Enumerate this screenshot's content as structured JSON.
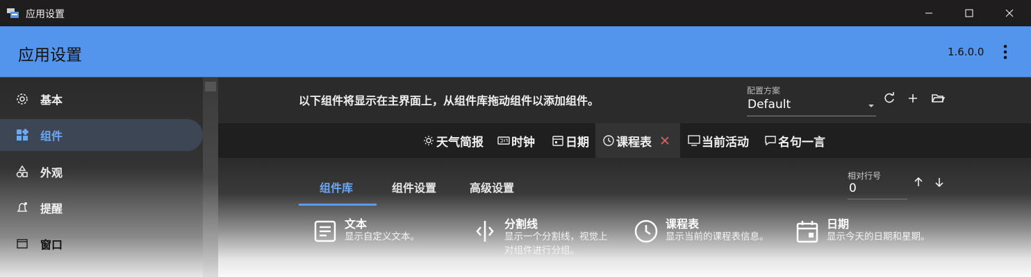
{
  "window": {
    "title": "应用设置",
    "controls": {
      "minimize": "minimize-icon",
      "maximize": "maximize-icon",
      "close": "close-icon"
    }
  },
  "header": {
    "title": "应用设置",
    "version": "1.6.0.0"
  },
  "sidebar": {
    "items": [
      {
        "label": "基本",
        "icon": "gear-icon",
        "active": false
      },
      {
        "label": "组件",
        "icon": "widgets-icon",
        "active": true
      },
      {
        "label": "外观",
        "icon": "shapes-icon",
        "active": false
      },
      {
        "label": "提醒",
        "icon": "bell-icon",
        "active": false
      },
      {
        "label": "窗口",
        "icon": "window-icon",
        "active": false
      }
    ]
  },
  "toolbar": {
    "description": "以下组件将显示在主界面上，从组件库拖动组件以添加组件。",
    "scheme_label": "配置方案",
    "scheme_value": "Default"
  },
  "components_strip": [
    {
      "label": "天气简报",
      "icon": "sun-icon"
    },
    {
      "label": "时钟",
      "icon": "clock-digital-icon"
    },
    {
      "label": "日期",
      "icon": "calendar-icon"
    },
    {
      "label": "课程表",
      "icon": "clock-icon",
      "selected": true
    },
    {
      "label": "当前活动",
      "icon": "monitor-icon"
    },
    {
      "label": "名句一言",
      "icon": "chat-icon"
    }
  ],
  "tabs": [
    {
      "label": "组件库",
      "active": true
    },
    {
      "label": "组件设置",
      "active": false
    },
    {
      "label": "高级设置",
      "active": false
    }
  ],
  "row_field": {
    "label": "相对行号",
    "value": "0"
  },
  "library": [
    {
      "title": "文本",
      "desc": "显示自定义文本。",
      "icon": "text-icon"
    },
    {
      "title": "分割线",
      "desc": "显示一个分割线，视觉上对组件进行分组。",
      "icon": "separator-icon"
    },
    {
      "title": "课程表",
      "desc": "显示当前的课程表信息。",
      "icon": "clock-icon"
    },
    {
      "title": "日期",
      "desc": "显示今天的日期和星期。",
      "icon": "calendar-icon"
    }
  ],
  "colors": {
    "accent": "#5394ec",
    "titlebar": "#201d1f",
    "active_text": "#6ea8f2"
  }
}
